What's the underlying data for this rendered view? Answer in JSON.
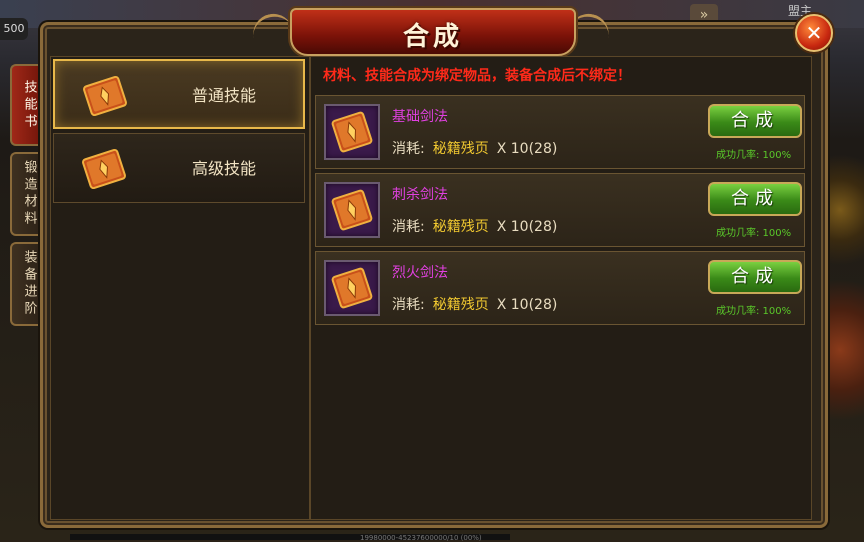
{
  "window": {
    "title": "合成",
    "close_label": "✕"
  },
  "background": {
    "level_badge": "500",
    "top_right_text": "盟主",
    "top_arrow": "»",
    "bottom_text": "19980000-45237600000/10 (00%)"
  },
  "side_tabs": [
    {
      "label": "技能书",
      "active": true
    },
    {
      "label": "锻造材料",
      "active": false
    },
    {
      "label": "装备进阶",
      "active": false
    }
  ],
  "categories": [
    {
      "label": "普通技能",
      "active": true
    },
    {
      "label": "高级技能",
      "active": false
    }
  ],
  "notice": "材料、技能合成为绑定物品，装备合成后不绑定！",
  "recipes": [
    {
      "name": "基础剑法",
      "cost_label": "消耗:",
      "material": "秘籍残页",
      "quantity": "X 10(28)",
      "button": "合成",
      "success_rate": "成功几率: 100%"
    },
    {
      "name": "刺杀剑法",
      "cost_label": "消耗:",
      "material": "秘籍残页",
      "quantity": "X 10(28)",
      "button": "合成",
      "success_rate": "成功几率: 100%"
    },
    {
      "name": "烈火剑法",
      "cost_label": "消耗:",
      "material": "秘籍残页",
      "quantity": "X 10(28)",
      "button": "合成",
      "success_rate": "成功几率: 100%"
    }
  ],
  "colors": {
    "notice": "#ff2a1a",
    "skill_name": "#e040e0",
    "material": "#f0c830",
    "success_rate": "#5ac82a",
    "accent_gold": "#e8b84a"
  }
}
